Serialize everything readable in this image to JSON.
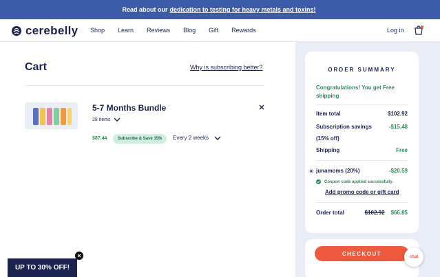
{
  "banner": {
    "prefix": "Read about our",
    "link": "dedication to testing for heavy metals and toxins!"
  },
  "nav": {
    "logo_text": "cerebelly",
    "links": [
      "Shop",
      "Learn",
      "Reviews",
      "Blog",
      "Gift",
      "Rewards"
    ],
    "login": "Log in",
    "bag_icon": "shopping-bag-icon"
  },
  "cart": {
    "title": "Cart",
    "why_link": "Why is subscribing better?",
    "item": {
      "name": "5-7 Months Bundle",
      "items_count": "28 items",
      "price": "$87.44",
      "badge": "Subscribe & Save 15%",
      "frequency": "Every 2 weeks"
    }
  },
  "summary": {
    "title": "ORDER SUMMARY",
    "congrats": "Congratulations! You get Free shipping",
    "item_total_label": "Item total",
    "item_total_value": "$102.92",
    "savings_label": "Subscription savings (15% off)",
    "savings_value": "-$15.48",
    "shipping_label": "Shipping",
    "shipping_value": "Free",
    "coupon_label": "junamoms (20%)",
    "coupon_value": "-$20.59",
    "coupon_status": "Coupon code applied successfully.",
    "promo_link": "Add promo code or gift card",
    "order_total_label": "Order total",
    "order_total_original": "$102.92",
    "order_total_value": "$66.85"
  },
  "checkout": {
    "button": "CHECKOUT",
    "chat": "chat"
  },
  "promo": {
    "text": "UP TO 30% OFF!"
  },
  "colors": {
    "navy": "#1b2451",
    "banner_blue": "#3c5ba9",
    "accent_orange": "#ef5a3c",
    "success_green": "#2e8a5a"
  }
}
